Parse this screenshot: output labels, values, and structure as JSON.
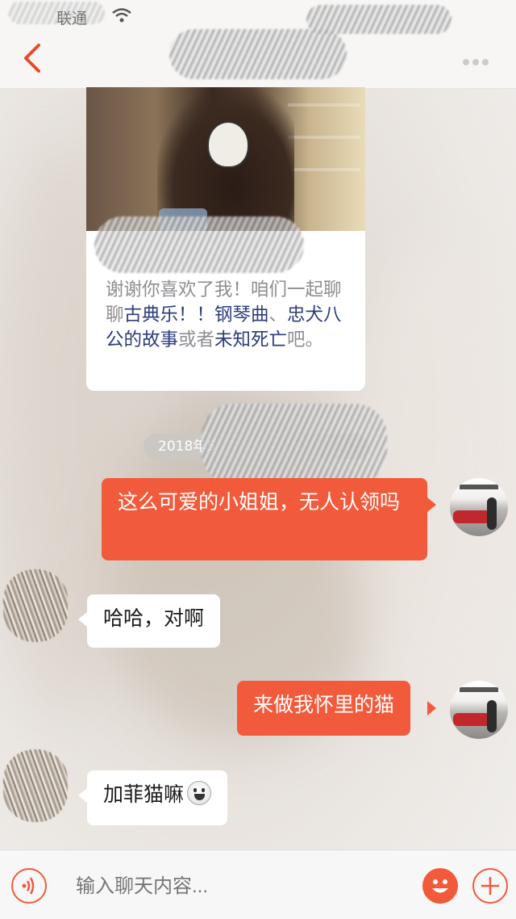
{
  "status_bar": {
    "carrier": "联通"
  },
  "card": {
    "title": "",
    "body_parts": [
      {
        "text": "谢谢你喜欢了我！咱们一起聊聊",
        "highlight": false
      },
      {
        "text": "古典乐！！钢琴曲",
        "highlight": true
      },
      {
        "text": "、",
        "highlight": false
      },
      {
        "text": "忠犬八公的故事",
        "highlight": true
      },
      {
        "text": "或者",
        "highlight": false
      },
      {
        "text": "未知死亡",
        "highlight": true
      },
      {
        "text": "吧。",
        "highlight": false
      }
    ]
  },
  "time_pill": "2018年5",
  "messages": [
    {
      "side": "out",
      "text": "这么可爱的小姐姐，无人认领吗"
    },
    {
      "side": "in",
      "text": "哈哈，对啊"
    },
    {
      "side": "out",
      "text": "来做我怀里的猫"
    },
    {
      "side": "in",
      "text": "加菲猫嘛"
    }
  ],
  "input": {
    "placeholder": "输入聊天内容..."
  },
  "colors": {
    "accent": "#f15a3b",
    "link": "#2b3c7a",
    "bubble_in": "#ffffff"
  }
}
